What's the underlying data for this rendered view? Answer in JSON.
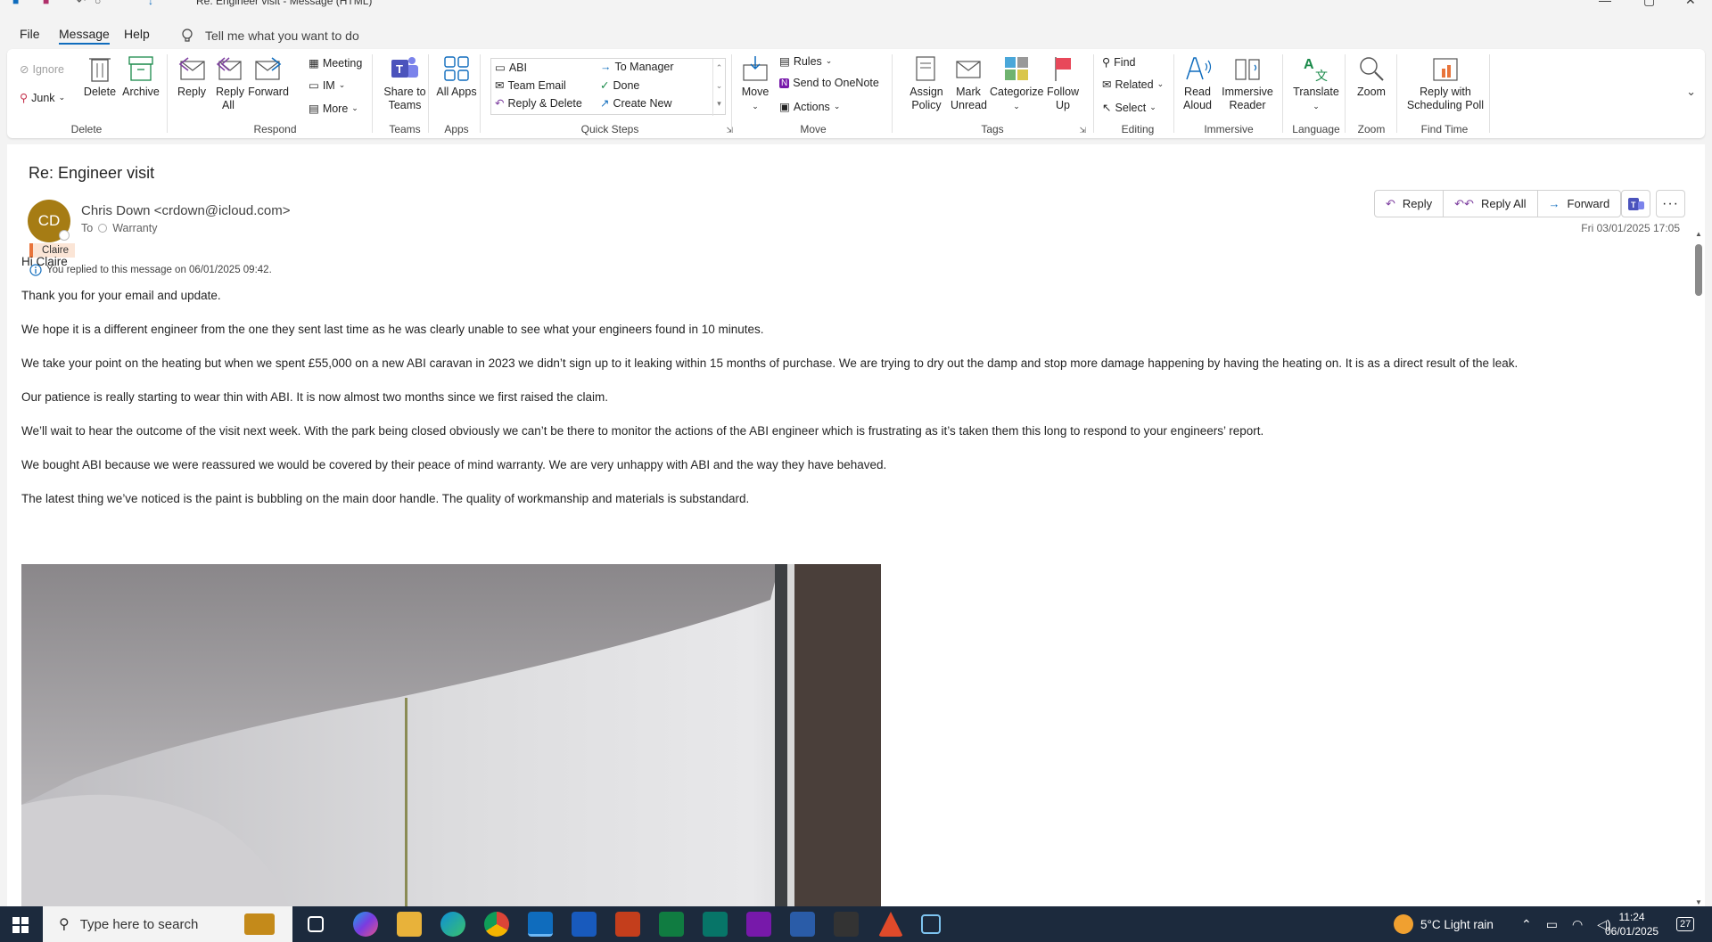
{
  "window": {
    "title": "Re: Engineer visit  -  Message (HTML)"
  },
  "menu": {
    "tabs": [
      "File",
      "Message",
      "Help"
    ],
    "tell_me": "Tell me what you want to do"
  },
  "ribbon": {
    "delete": {
      "ignore": "Ignore",
      "junk": "Junk",
      "delete": "Delete",
      "archive": "Archive",
      "label": "Delete"
    },
    "respond": {
      "reply": "Reply",
      "reply_all": "Reply All",
      "forward": "Forward",
      "meeting": "Meeting",
      "im": "IM",
      "more": "More",
      "label": "Respond"
    },
    "teams": {
      "share": "Share to Teams",
      "label": "Teams"
    },
    "apps": {
      "all": "All Apps",
      "label": "Apps"
    },
    "quick_steps": {
      "items": [
        "ABI",
        "To Manager",
        "Team Email",
        "Done",
        "Reply & Delete",
        "Create New"
      ],
      "label": "Quick Steps"
    },
    "move": {
      "move": "Move",
      "rules": "Rules",
      "onenote": "Send to OneNote",
      "actions": "Actions",
      "label": "Move"
    },
    "tags": {
      "assign": "Assign Policy",
      "mark_unread": "Mark Unread",
      "categorize": "Categorize",
      "follow_up": "Follow Up",
      "label": "Tags"
    },
    "editing": {
      "find": "Find",
      "related": "Related",
      "select": "Select",
      "label": "Editing"
    },
    "immersive": {
      "read_aloud": "Read Aloud",
      "reader": "Immersive Reader",
      "label": "Immersive"
    },
    "language": {
      "translate": "Translate",
      "label": "Language"
    },
    "zoom": {
      "zoom": "Zoom",
      "label": "Zoom"
    },
    "find_time": {
      "poll": "Reply with Scheduling Poll",
      "label": "Find Time"
    }
  },
  "message": {
    "subject": "Re: Engineer visit",
    "avatar_initials": "CD",
    "from": "Chris Down <crdown@icloud.com>",
    "to_label": "To",
    "to": "Warranty",
    "category": "Claire",
    "replied_info": "You replied to this message on 06/01/2025 09:42.",
    "date": "Fri 03/01/2025 17:05",
    "buttons": {
      "reply": "Reply",
      "reply_all": "Reply All",
      "forward": "Forward"
    },
    "body": [
      "Hi Claire",
      "Thank you for your email and update.",
      "We hope it is a different engineer from the one they sent last time as he was clearly unable to see what your engineers found in 10 minutes.",
      "We take your point on the heating but when we spent £55,000 on a new ABI caravan in 2023 we didn’t sign up to it leaking within 15 months of purchase. We are trying to dry out the damp and stop more damage happening by having the heating on. It is as a direct result of the leak.",
      "Our patience is really starting to wear thin with ABI. It is now almost two months since we first raised the claim.",
      "We’ll wait to hear the outcome of the visit next week. With the park being closed obviously we can’t be there to monitor the actions of the ABI engineer which is frustrating as it’s taken them this long to respond to your engineers’ report.",
      "We bought ABI because we were reassured we would be covered by their peace of mind warranty. We are very unhappy with ABI and the way they have behaved.",
      "The latest thing we’ve noticed is the paint is bubbling on the main door handle. The quality of workmanship and materials is substandard."
    ]
  },
  "taskbar": {
    "search_placeholder": "Type here to search",
    "weather": "5°C  Light rain",
    "time": "11:24",
    "date": "06/01/2025",
    "notifications": "27"
  },
  "colors": {
    "accent": "#0f6cbd",
    "avatar": "#a67c14",
    "category": "#e8743b",
    "taskbar": "#1c2a3d"
  }
}
